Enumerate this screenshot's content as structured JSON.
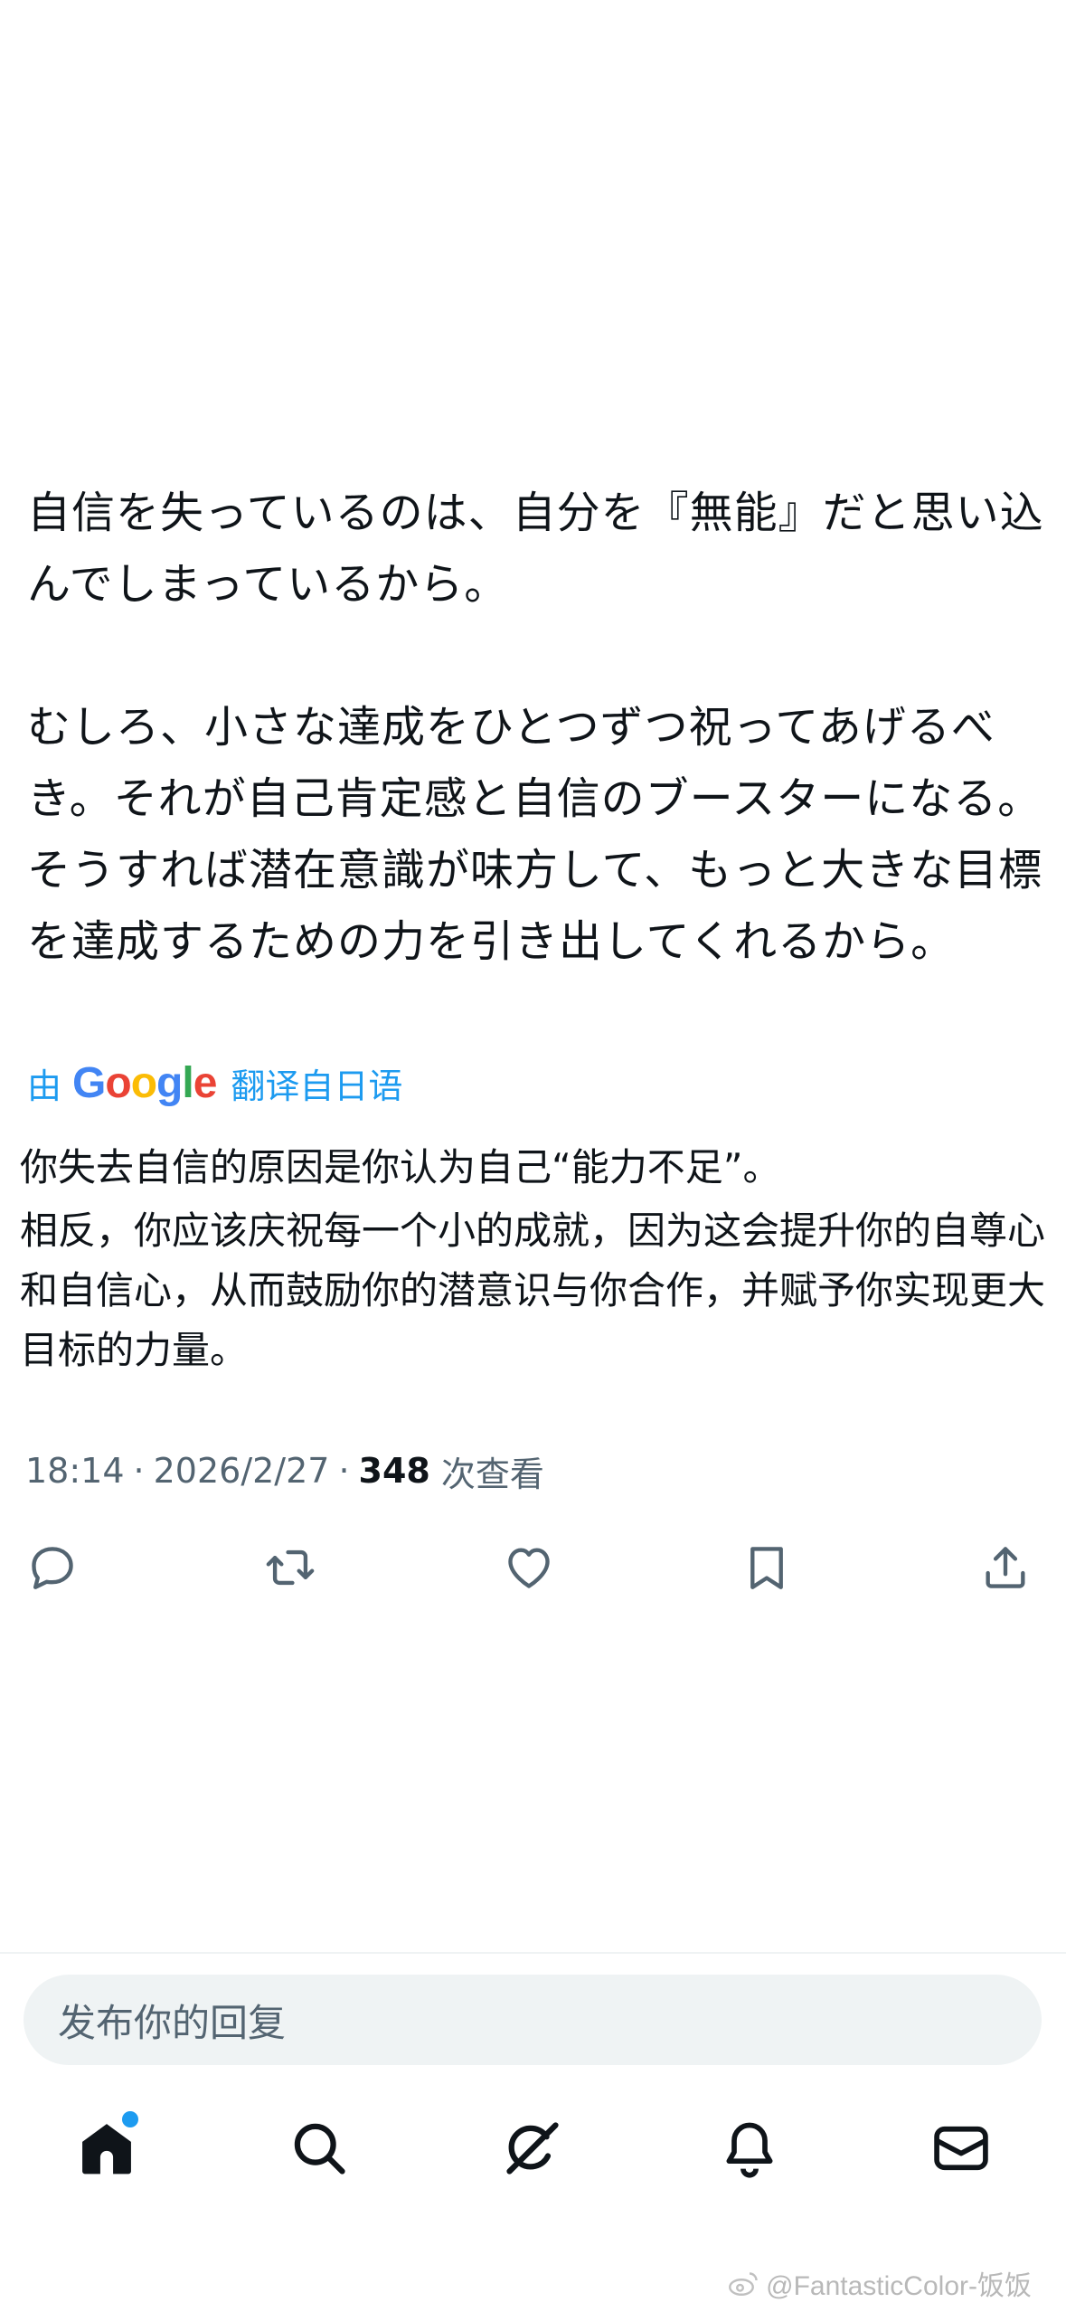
{
  "post": {
    "paragraphs": [
      "自信を失っているのは、自分を『無能』だと思い込んでしまっているから。",
      "むしろ、小さな達成をひとつずつ祝ってあげるべき。それが自己肯定感と自信のブースターになる。そうすれば潜在意識が味方して、もっと大きな目標を達成するための力を引き出してくれるから。"
    ]
  },
  "translation": {
    "by_label": "由",
    "logo_letters": [
      "G",
      "o",
      "o",
      "g",
      "l",
      "e"
    ],
    "link_label": "翻译自日语",
    "paragraphs": [
      "你失去自信的原因是你认为自己“能力不足”。",
      "相反，你应该庆祝每一个小的成就，因为这会提升你的自尊心和自信心，从而鼓励你的潜意识与你合作，并赋予你实现更大目标的力量。"
    ]
  },
  "meta": {
    "time": "18:14",
    "separator": "·",
    "date": "2026/2/27",
    "views_count": "348",
    "views_label": "次查看"
  },
  "actions": [
    {
      "icon": "reply-icon"
    },
    {
      "icon": "repost-icon"
    },
    {
      "icon": "like-icon"
    },
    {
      "icon": "bookmark-icon"
    },
    {
      "icon": "share-icon"
    }
  ],
  "reply": {
    "placeholder": "发布你的回复"
  },
  "tabbar": {
    "items": [
      {
        "icon": "home-icon",
        "active": true,
        "has_notification_dot": true
      },
      {
        "icon": "search-icon"
      },
      {
        "icon": "grok-icon"
      },
      {
        "icon": "notifications-icon"
      },
      {
        "icon": "messages-icon"
      }
    ],
    "accent_color": "#1d9bf0"
  },
  "watermark": {
    "text": "@FantasticColor-饭饭"
  }
}
